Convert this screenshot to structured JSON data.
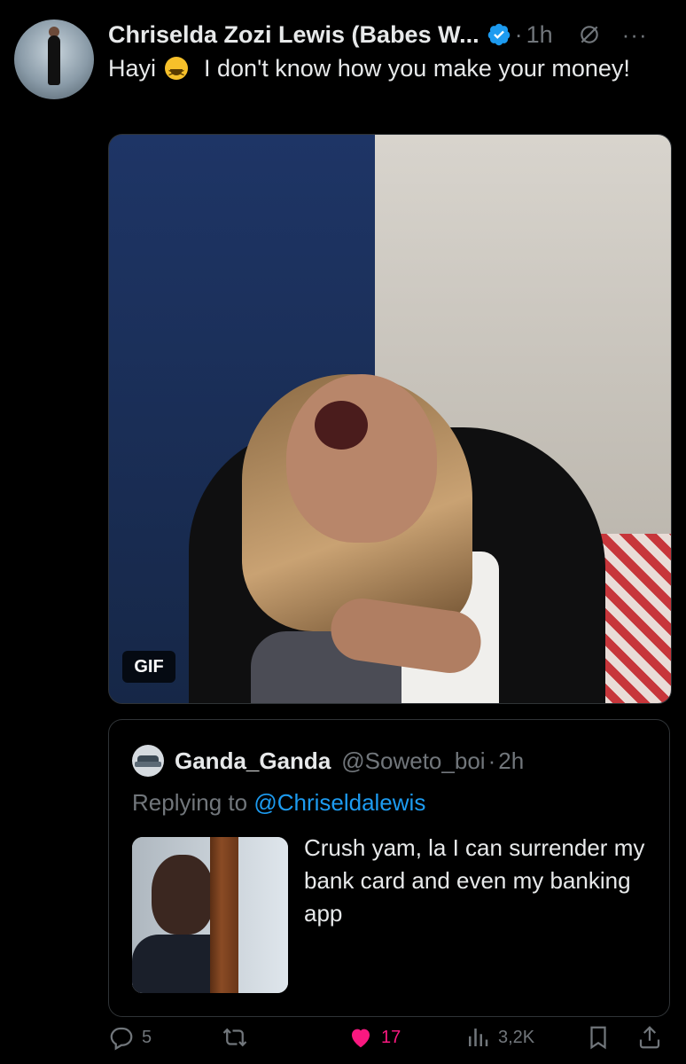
{
  "tweet": {
    "author_name": "Chriselda Zozi Lewis (Babes W...",
    "separator": "·",
    "time": "1h",
    "more_label": "···",
    "text_before_emoji": "Hayi",
    "emoji": "grinning-squinting-face",
    "text_after_emoji": "I don't know how you make your money!",
    "media_badge": "GIF"
  },
  "quote": {
    "author_name": "Ganda_Ganda",
    "handle": "@Soweto_boi",
    "separator": "·",
    "time": "2h",
    "replying_prefix": "Replying to",
    "replying_to": "@Chriseldalewis",
    "text": "Crush yam, la I can surrender my bank card and even my banking app"
  },
  "actions": {
    "replies": "5",
    "reposts": "",
    "likes": "17",
    "views": "3,2K"
  },
  "colors": {
    "background": "#000000",
    "text": "#e7e9ea",
    "muted": "#71767b",
    "link": "#1d9bf0",
    "like": "#f91880",
    "verified": "#1d9bf0"
  }
}
